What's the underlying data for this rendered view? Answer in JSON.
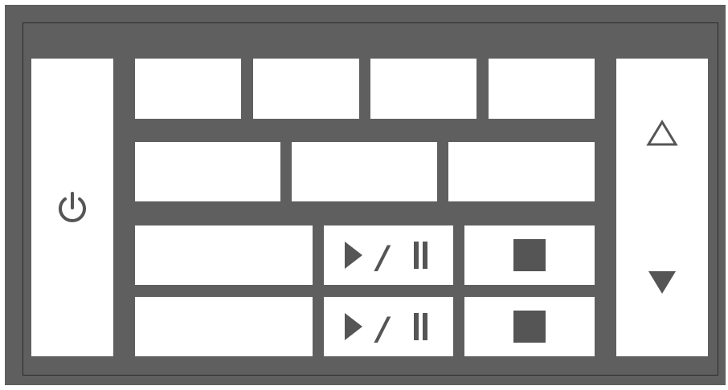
{
  "panel": {
    "title": "",
    "colors": {
      "background": "#5f5f5f",
      "button": "#ffffff",
      "icon": "#555555",
      "frame_line": "#2a2a2a"
    }
  },
  "left": {
    "power_button": {
      "label": "",
      "icon": "power-icon"
    }
  },
  "grid": {
    "row1": [
      {
        "label": ""
      },
      {
        "label": ""
      },
      {
        "label": ""
      },
      {
        "label": ""
      }
    ],
    "row2": [
      {
        "label": ""
      },
      {
        "label": ""
      },
      {
        "label": ""
      }
    ],
    "row3": {
      "blank": {
        "label": ""
      },
      "play_pause": {
        "icon": "play-pause-icon",
        "slash": "/"
      },
      "stop": {
        "icon": "stop-icon"
      }
    },
    "row4": {
      "blank": {
        "label": ""
      },
      "play_pause": {
        "icon": "play-pause-icon",
        "slash": "/"
      },
      "stop": {
        "icon": "stop-icon"
      }
    }
  },
  "right": {
    "up_button": {
      "icon": "triangle-up-outline-icon"
    },
    "down_button": {
      "icon": "triangle-down-filled-icon"
    }
  }
}
